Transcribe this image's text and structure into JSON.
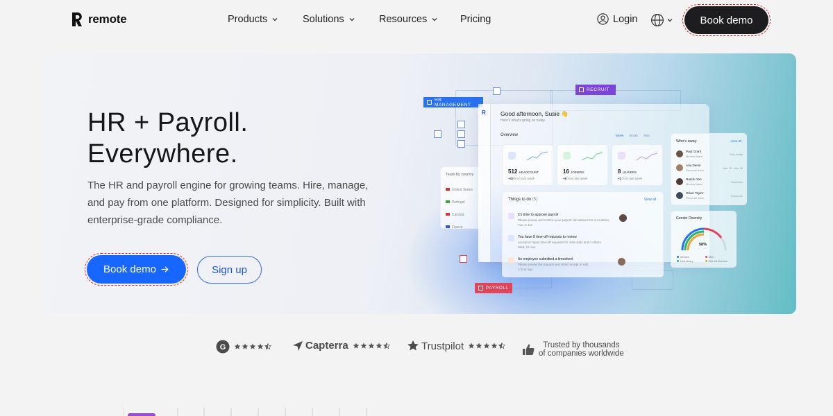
{
  "brand": {
    "name": "remote"
  },
  "nav": {
    "items": [
      {
        "label": "Products",
        "has_dropdown": true
      },
      {
        "label": "Solutions",
        "has_dropdown": true
      },
      {
        "label": "Resources",
        "has_dropdown": true
      },
      {
        "label": "Pricing",
        "has_dropdown": false
      }
    ],
    "login_label": "Login",
    "book_demo_label": "Book demo"
  },
  "hero": {
    "title_line1": "HR + Payroll.",
    "title_line2": "Everywhere.",
    "description": "The HR and payroll engine for growing teams. Hire, manage, and pay from one platform. Designed for simplicity. Built with enterprise-grade compliance.",
    "primary_cta": "Book demo",
    "secondary_cta": "Sign up"
  },
  "dashboard": {
    "tags": {
      "hr": "HR MANAGEMENT",
      "recruit": "RECRUIT",
      "payroll": "PAYROLL"
    },
    "greeting": "Good afternoon, Susie 👋",
    "greeting_sub": "Here's what's going on today.",
    "overview_label": "Overview",
    "periods": [
      "Week",
      "Month",
      "Year"
    ],
    "stats": [
      {
        "value": "512",
        "label": "HEADCOUNT",
        "delta": "+10",
        "delta_text": "from last week"
      },
      {
        "value": "16",
        "label": "JOINERS",
        "delta": "+5",
        "delta_text": "from last week"
      },
      {
        "value": "8",
        "label": "LEAVERS",
        "delta": "+2",
        "delta_text": "from last week"
      }
    ],
    "todo_label": "Things to do",
    "todo_count": "(5)",
    "view_all": "View all",
    "todos": [
      {
        "title": "It's time to approve payroll",
        "sub": "Please review and confirm your payroll calculations for 3 countries",
        "meta": "Tue, 6 Jun"
      },
      {
        "title": "You have 8 time-off requests to review",
        "sub": "Accept or reject time-off requests for Julia Sato and 4 others.",
        "meta": "Wed, 15 Jun"
      },
      {
        "title": "An employee submitted a timesheet",
        "sub": "Please review the request and either accept or edit.",
        "meta": "1 hour ago"
      }
    ],
    "whos_away": {
      "label": "Who's away",
      "view_all": "View all",
      "people": [
        {
          "name": "Paul Grant",
          "reason": "Medical leave",
          "when": "Only today"
        },
        {
          "name": "Aria Demir",
          "reason": "Personal leave",
          "when": "Mar 15 - Mar 16"
        },
        {
          "name": "Nandu Yan",
          "reason": "Medical leave",
          "when": "Tomorrow"
        },
        {
          "name": "Oliver Taylor",
          "reason": "Personal leave",
          "when": "Tomorrow"
        }
      ]
    },
    "country": {
      "label": "Team by country",
      "items": [
        "United States",
        "Portugal",
        "Canada",
        "France"
      ]
    },
    "diversity": {
      "label": "Gender Diversity",
      "percent": "58%",
      "legend": [
        "Women",
        "Men",
        "Non-binary",
        "Did not disclose"
      ]
    }
  },
  "social_proof": {
    "g2_rating": 4.5,
    "capterra": "Capterra",
    "capterra_rating": 4.5,
    "trustpilot": "Trustpilot",
    "trustpilot_rating": 4.5,
    "trusted_line1": "Trusted by thousands",
    "trusted_line2": "of companies worldwide"
  },
  "colors": {
    "primary": "#1766ff",
    "dark_button": "#1d1d1f",
    "hr_tag": "#2a71ef",
    "recruit_tag": "#7c44d8",
    "payroll_tag": "#e0455c",
    "hero_teal": "#62bdc4"
  }
}
